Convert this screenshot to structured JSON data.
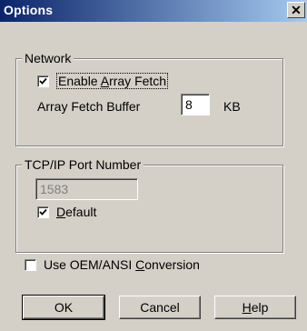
{
  "window": {
    "title": "Options",
    "close_glyph": "✕"
  },
  "network": {
    "group_label": "Network",
    "enable_array_fetch": {
      "checked": true,
      "label_pre": "Enable ",
      "label_accel": "A",
      "label_post": "rray Fetch"
    },
    "array_fetch_buffer": {
      "label": "Array Fetch Buffer",
      "value": "8",
      "unit": "KB"
    }
  },
  "tcpip": {
    "group_label": "TCP/IP Port Number",
    "port_value": "1583",
    "port_disabled": true,
    "default": {
      "checked": true,
      "label_accel": "D",
      "label_post": "efault"
    }
  },
  "oem_ansi": {
    "checked": false,
    "label_pre": "Use OEM/ANSI ",
    "label_accel": "C",
    "label_post": "onversion"
  },
  "buttons": {
    "ok": "OK",
    "cancel": "Cancel",
    "help_accel": "H",
    "help_post": "elp"
  }
}
